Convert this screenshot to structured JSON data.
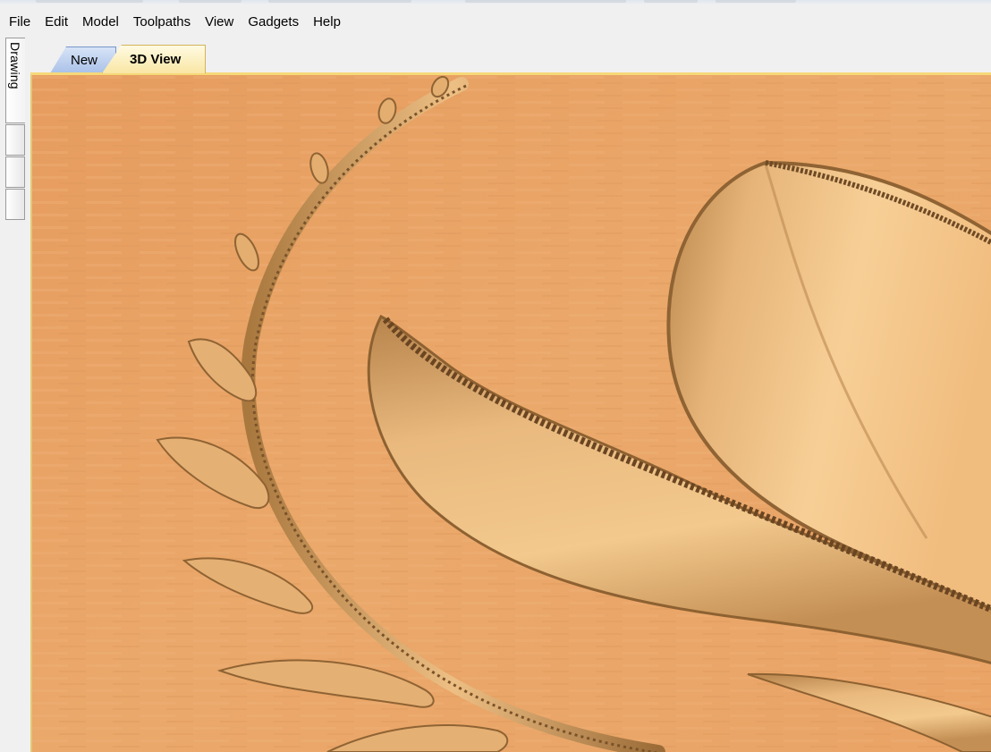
{
  "menu": {
    "items": [
      "File",
      "Edit",
      "Model",
      "Toolpaths",
      "View",
      "Gadgets",
      "Help"
    ]
  },
  "side_panel": {
    "drawing_tab": "Drawing"
  },
  "tabs": {
    "new_label": "New",
    "view3d_label": "3D View"
  },
  "viewport": {
    "content": "3d-carved-relief-model",
    "icon": "3d-model-preview"
  },
  "colors": {
    "wood_base": "#e9a566",
    "wood_light": "#f3c486",
    "active_tab": "#f9e6a4",
    "inactive_tab": "#a9c1e8"
  }
}
